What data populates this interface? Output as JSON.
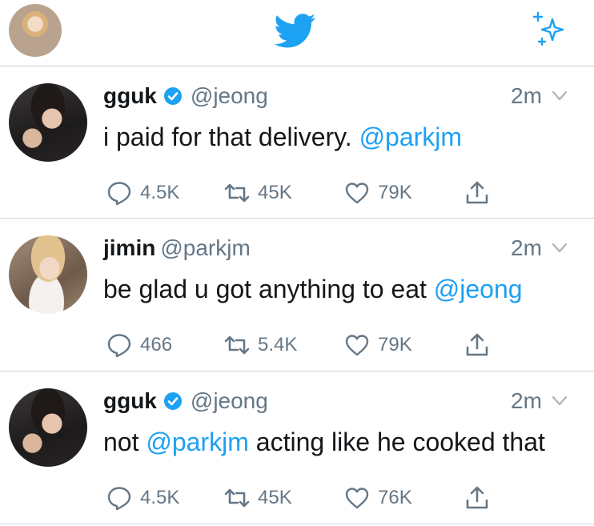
{
  "header": {
    "logo_icon": "twitter-bird-icon",
    "sparkle_icon": "sparkle-icon"
  },
  "colors": {
    "brand": "#1da1f2",
    "text": "#14171a",
    "secondary": "#657786",
    "divider": "#cfd5db"
  },
  "tweets": [
    {
      "name": "gguk",
      "verified": true,
      "handle": "@jeong",
      "time": "2m",
      "text_before": "i paid for that delivery. ",
      "mention": "@parkjm",
      "text_after": "",
      "replies": "4.5K",
      "retweets": "45K",
      "likes": "79K"
    },
    {
      "name": "jimin",
      "verified": false,
      "handle": "@parkjm",
      "time": "2m",
      "text_before": "be glad u got anything to eat ",
      "mention": "@jeong",
      "text_after": "",
      "replies": "466",
      "retweets": "5.4K",
      "likes": "79K"
    },
    {
      "name": "gguk",
      "verified": true,
      "handle": "@jeong",
      "time": "2m",
      "text_before": "not ",
      "mention": "@parkjm",
      "text_after": " acting like he cooked that",
      "replies": "4.5K",
      "retweets": "45K",
      "likes": "76K"
    }
  ]
}
